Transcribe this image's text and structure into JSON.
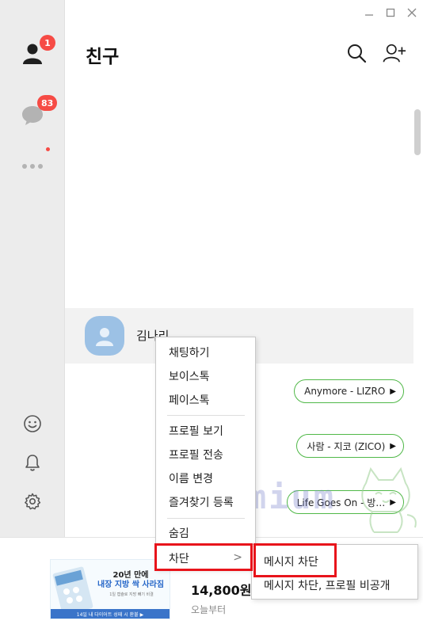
{
  "rail": {
    "friends_badge": "1",
    "chats_badge": "83"
  },
  "header": {
    "title": "친구"
  },
  "friends": [
    {
      "name": "김나리"
    }
  ],
  "music": [
    {
      "label": "Anymore - LIZRO"
    },
    {
      "label": "사람 - 지코 (ZICO)"
    },
    {
      "label": "Life Goes On - 방…"
    }
  ],
  "context_menu": {
    "items": [
      "채팅하기",
      "보이스톡",
      "페이스톡",
      "프로필 보기",
      "프로필 전송",
      "이름 변경",
      "즐겨찾기 등록",
      "숨김",
      "차단"
    ],
    "chevron": ">"
  },
  "submenu": {
    "items": [
      "메시지 차단",
      "메시지 차단, 프로필 비공개"
    ]
  },
  "ad": {
    "headline_1": "20년 만에",
    "headline_2": "내장 지방 싹 사라짐",
    "subcopy": "1일 캡슐로 지방 빼기 비결",
    "strip": "14일 내 다이어트 성패 시 환불 ▶",
    "price": "14,800원",
    "brand": "오늘부터"
  },
  "watermark": "Premium",
  "colors": {
    "accent_green": "#50b848",
    "badge_red": "#f64b45",
    "highlight_red": "#e8141b",
    "avatar_blue": "#9cc1e5"
  },
  "icons": [
    "person-icon",
    "chat-bubble-icon",
    "more-dots-icon",
    "emoji-icon",
    "bell-icon",
    "gear-icon",
    "search-icon",
    "add-friend-icon",
    "minimize-icon",
    "maximize-icon",
    "close-icon",
    "play-icon"
  ]
}
